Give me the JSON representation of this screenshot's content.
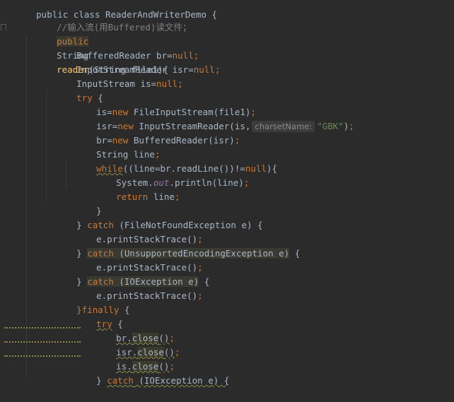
{
  "header": {
    "class_decl": "public class ReaderAndWriterDemo {"
  },
  "comment": "//输入流(用Buffered)读文件；",
  "method": {
    "modifier": "public",
    "return_type": "String",
    "name": "reader",
    "params": "(String file1){"
  },
  "vars": {
    "br_decl": "BufferedReader br=",
    "isr_decl": "InputStreamReader isr=",
    "is_decl": "InputStream is=",
    "null": "null",
    "semi": ";"
  },
  "try_block": {
    "try": "try",
    "open": " {",
    "is_assign": "is=",
    "new": "new",
    "fis": " FileInputStream(file1)",
    "isr_assign": "isr=",
    "isr_new": " InputStreamReader(is,",
    "hint_label": "charsetName:",
    "charset": "\"GBK\"",
    "close_paren": ")",
    "br_assign": "br=",
    "br_new": " BufferedReader(isr)",
    "line_decl": "String line",
    "while": "while",
    "while_cond_a": "((line=br.readLine())!=",
    "while_cond_b": "){",
    "sys_a": "System.",
    "sys_out": "out",
    "sys_b": ".println(line)",
    "return": "return",
    "return_val": " line",
    "close_brace": "}"
  },
  "catches": [
    {
      "brace": "} ",
      "kw": "catch",
      "rest": " (FileNotFoundException e) {",
      "body": "e.printStackTrace()"
    },
    {
      "brace": "} ",
      "kw": "catch",
      "rest": " (UnsupportedEncodingException e)",
      "tail": " {",
      "body": "e.printStackTrace()"
    },
    {
      "brace": "} ",
      "kw": "catch",
      "rest": " (IOException e)",
      "tail": " {",
      "body": "e.printStackTrace()"
    }
  ],
  "finally_block": {
    "open": "}finally",
    "brace": " {",
    "try": "try",
    "try_brace": " {",
    "br_close_a": "br.",
    "isr_close_a": "isr.",
    "is_close_a": "is.",
    "close_call": "close",
    "parens": "()",
    "catch_brace": "} ",
    "catch_kw": "catch",
    "catch_rest": " (IOException e) {"
  }
}
